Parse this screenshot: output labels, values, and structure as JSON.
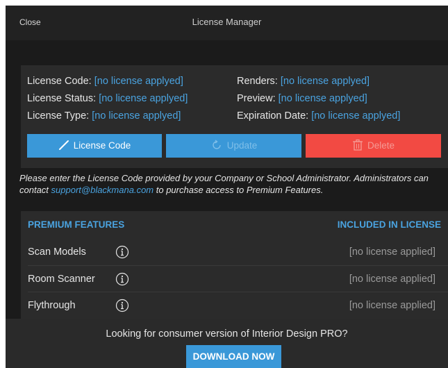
{
  "titlebar": {
    "close_label": "Close",
    "title": "License Manager"
  },
  "license_info": {
    "code_label": "License Code:",
    "code_value": "[no license applyed]",
    "status_label": "License Status:",
    "status_value": "[no license applyed]",
    "type_label": "License Type:",
    "type_value": "[no license applyed]",
    "renders_label": "Renders:",
    "renders_value": "[no license applyed]",
    "preview_label": "Preview:",
    "preview_value": "[no license applyed]",
    "expiration_label": "Expiration Date:",
    "expiration_value": "[no license applyed]"
  },
  "buttons": {
    "license_code": "License Code",
    "update": "Update",
    "delete": "Delete"
  },
  "notice": {
    "text_before": "Please enter the License Code provided by your Company or School Administrator. Administrators can contact ",
    "email": "support@blackmana.com",
    "text_after": " to purchase access to Premium Features."
  },
  "features": {
    "header_left": "PREMIUM FEATURES",
    "header_right": "INCLUDED IN LICENSE",
    "rows": [
      {
        "name": "Scan Models",
        "status": "[no license applied]"
      },
      {
        "name": "Room Scanner",
        "status": "[no license applied]"
      },
      {
        "name": "Flythrough",
        "status": "[no license applied]"
      }
    ]
  },
  "footer": {
    "text": "Looking for consumer version of Interior Design PRO?",
    "download_label": "DOWNLOAD NOW"
  },
  "colors": {
    "accent": "#3a98d8",
    "danger": "#f24a43",
    "link": "#4aa3e0",
    "background": "#1b1b1b"
  }
}
